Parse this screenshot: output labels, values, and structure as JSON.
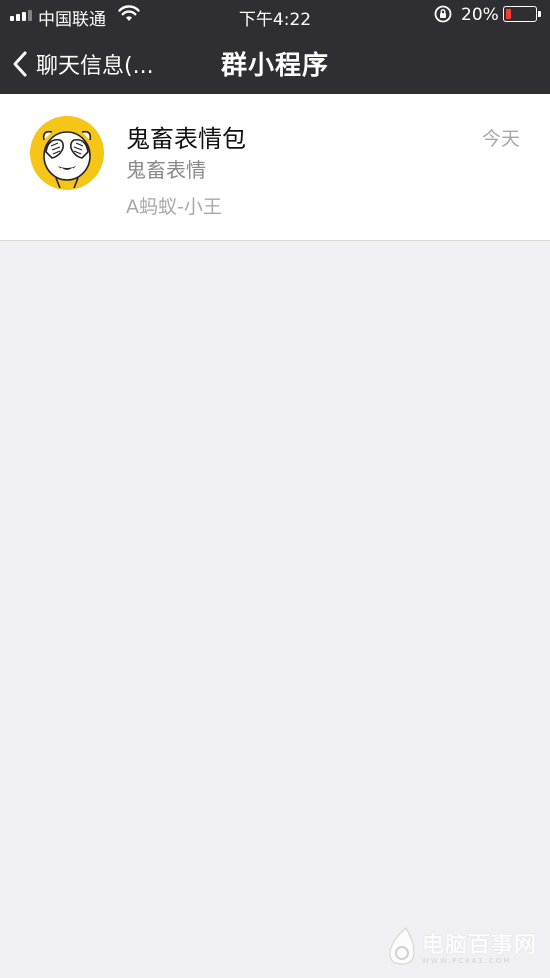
{
  "status_bar": {
    "carrier": "中国联通",
    "time": "下午4:22",
    "battery_percent": "20%",
    "battery_level": 0.2,
    "battery_color": "#ff3b30"
  },
  "nav": {
    "back_label": "聊天信息(...",
    "title": "群小程序",
    "background": "#2f2f33"
  },
  "list": {
    "items": [
      {
        "title": "鬼畜表情包",
        "subtitle": "鬼畜表情",
        "shared_by": "A蚂蚁-小王",
        "time": "今天",
        "icon": "cover-eyes-emoji-icon",
        "icon_color": "#f5c518"
      }
    ]
  },
  "watermark": {
    "text": "电脑百事网",
    "url": "WWW.PC841.COM"
  }
}
